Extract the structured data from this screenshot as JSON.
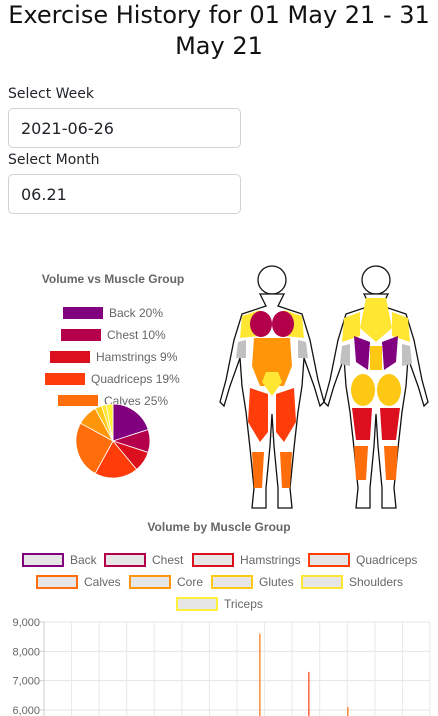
{
  "header": {
    "title": "Exercise History for 01 May 21 - 31 May 21"
  },
  "filters": {
    "week_label": "Select Week",
    "week_value": "2021-06-26",
    "month_label": "Select Month",
    "month_value": "06.21"
  },
  "pie_panel": {
    "title": "Volume vs Muscle Group",
    "legend": [
      {
        "label": "Back 20%",
        "color": "#800080"
      },
      {
        "label": "Chest 10%",
        "color": "#b4004b"
      },
      {
        "label": "Hamstrings 9%",
        "color": "#dc0f1e"
      },
      {
        "label": "Quadriceps 19%",
        "color": "#ff3c0a"
      },
      {
        "label": "Calves 25%",
        "color": "#ff6e0a"
      }
    ]
  },
  "body_map": {
    "icon": "muscle-body-diagram"
  },
  "chart_data": [
    {
      "type": "pie",
      "title": "Volume vs Muscle Group",
      "labels": [
        "Back",
        "Chest",
        "Hamstrings",
        "Quadriceps",
        "Calves",
        "Core",
        "Glutes",
        "Shoulders",
        "Triceps"
      ],
      "values": [
        20,
        10,
        9,
        19,
        25,
        9,
        3,
        2,
        3
      ],
      "colors": [
        "#800080",
        "#b4004b",
        "#dc0f1e",
        "#ff3c0a",
        "#ff6e0a",
        "#ff960a",
        "#ffc814",
        "#ffe632",
        "#fff03c"
      ]
    },
    {
      "type": "bar",
      "title": "Volume by Muscle Group",
      "series": [
        {
          "name": "Back",
          "color": "#800080"
        },
        {
          "name": "Chest",
          "color": "#b4004b"
        },
        {
          "name": "Hamstrings",
          "color": "#dc0f1e"
        },
        {
          "name": "Quadriceps",
          "color": "#ff3c0a"
        },
        {
          "name": "Calves",
          "color": "#ff6e0a"
        },
        {
          "name": "Core",
          "color": "#ff960a"
        },
        {
          "name": "Glutes",
          "color": "#ffc814"
        },
        {
          "name": "Shoulders",
          "color": "#ffe632"
        },
        {
          "name": "Triceps",
          "color": "#fff03c"
        }
      ],
      "y_ticks": [
        "9,000",
        "8,000",
        "7,000",
        "6,000"
      ],
      "ylim": [
        5800,
        9000
      ],
      "grid": true,
      "visible_bars": [
        {
          "series": "Calves",
          "value": 8600
        },
        {
          "series": "Quadriceps",
          "value": 7300
        },
        {
          "series": "Calves",
          "value": 6100
        }
      ]
    }
  ]
}
